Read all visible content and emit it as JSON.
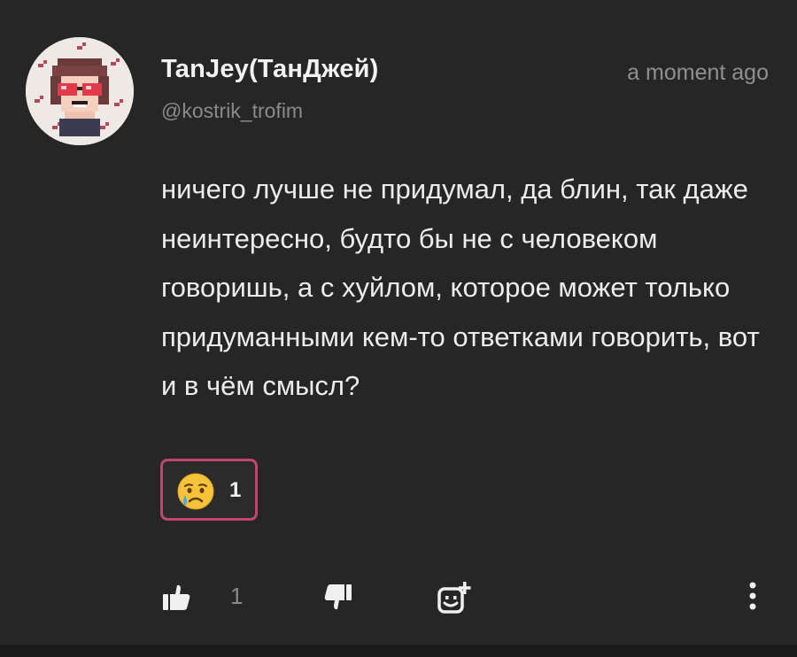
{
  "comment": {
    "author": {
      "display_name": "TanJey(ТанДжей)",
      "handle": "@kostrik_trofim",
      "avatar_icon": "pixel-art-avatar-icon"
    },
    "timestamp": "a moment ago",
    "text": "ничего лучше не придумал, да блин, так даже неинтересно, будто бы не с человеком говоришь, а с хуйлом, которое может только придуманными кем-то ответками говорить, вот и в чём смысл?",
    "reactions": [
      {
        "emoji_icon": "crying-face-icon",
        "count": "1",
        "border_color": "#c2456f"
      }
    ]
  },
  "actions": {
    "like_icon": "thumbs-up-icon",
    "like_count": "1",
    "dislike_icon": "thumbs-down-icon",
    "add_reaction_icon": "add-emoji-icon",
    "more_icon": "vertical-ellipsis-icon"
  },
  "colors": {
    "background": "#262626",
    "text": "#ececec",
    "muted": "#8a8a8a",
    "accent": "#c2456f"
  }
}
